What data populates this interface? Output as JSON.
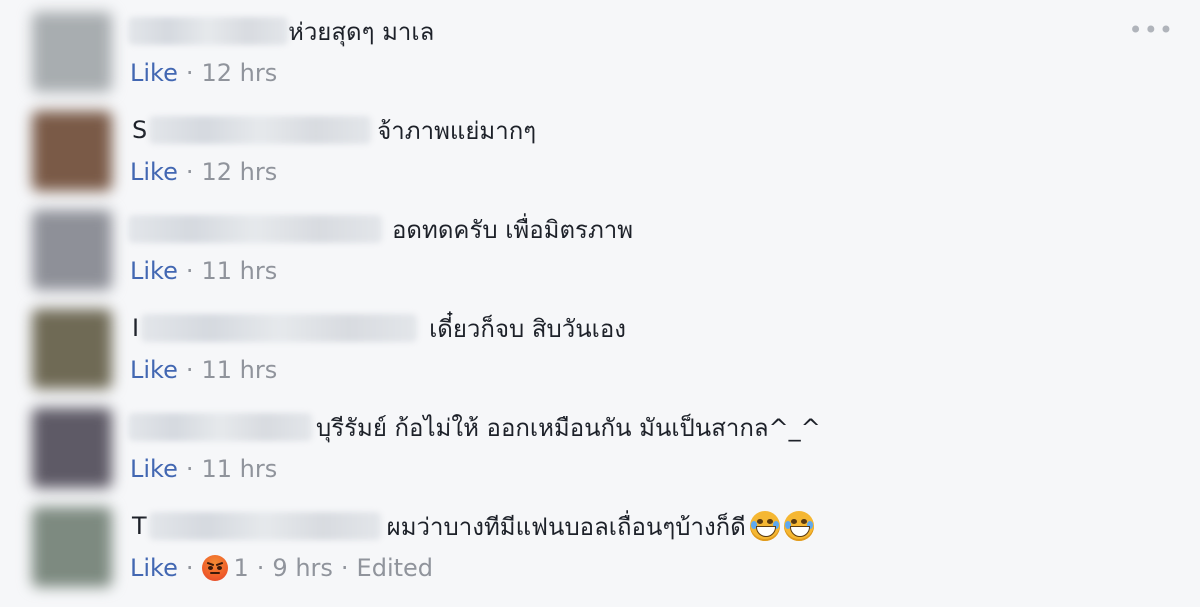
{
  "menu_icon": "more-horizontal-icon",
  "like_label": "Like",
  "separator": "·",
  "comments": [
    {
      "initial": "",
      "text": "ห่วยสุดๆ มาเล",
      "time": "12 hrs"
    },
    {
      "initial": "S",
      "text": "จ้าภาพแย่มากๆ",
      "time": "12 hrs"
    },
    {
      "initial": "",
      "text": "อดทดครับ เพื่อมิตรภาพ",
      "time": "11 hrs"
    },
    {
      "initial": "I",
      "text": "เดี๋ยวก็จบ สิบวันเอง",
      "time": "11 hrs"
    },
    {
      "initial": "",
      "text": "บุรีรัมย์ ก้อไม่ให้ ออกเหมือนกัน มันเป็นสากล^_^",
      "time": "11 hrs"
    },
    {
      "initial": "T",
      "text": "ผมว่าบางทีมีแฟนบอลเถื่อนๆบ้างก็ดี",
      "time": "9 hrs",
      "emojis": [
        "laughing-tears-emoji",
        "laughing-tears-emoji"
      ],
      "reaction_icon": "angry-reaction-icon",
      "reaction_count": "1",
      "edited_label": "Edited"
    }
  ]
}
